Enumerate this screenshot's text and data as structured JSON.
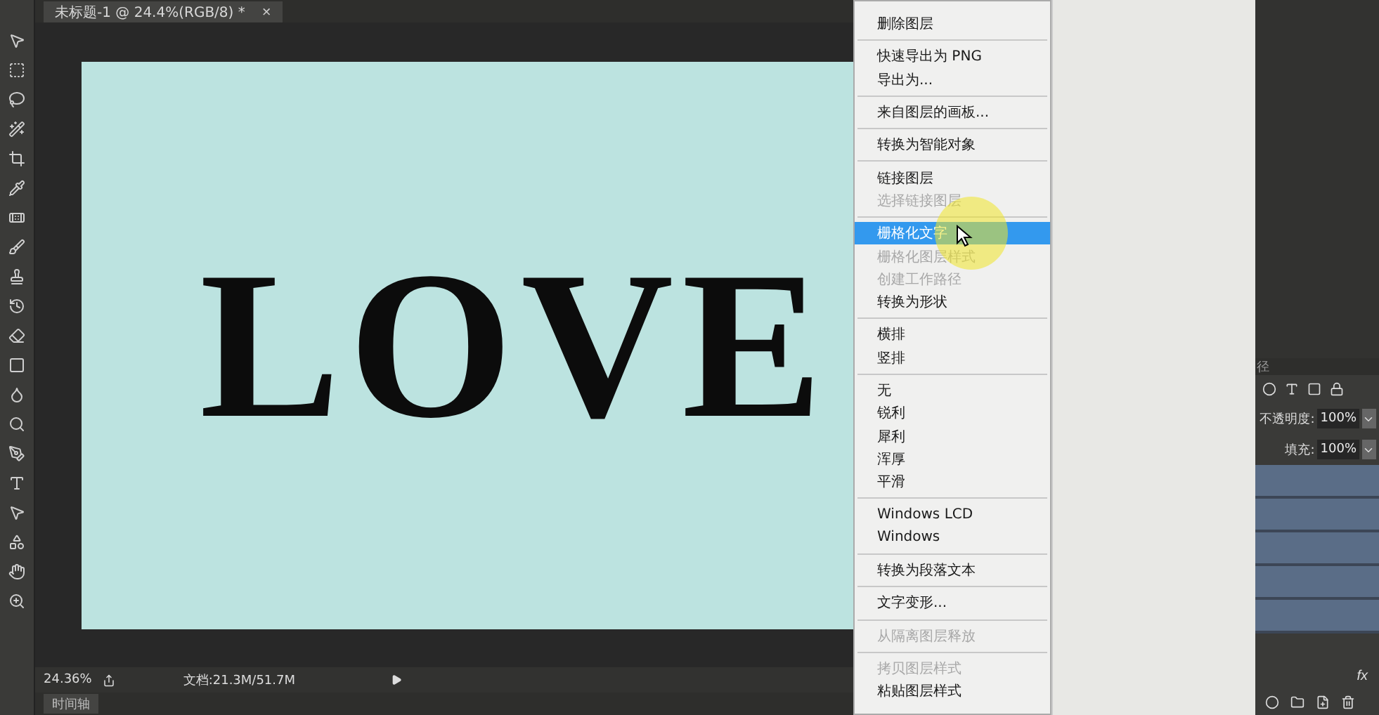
{
  "document_tab": {
    "title": "未标题-1 @ 24.4%(RGB/8) *",
    "close": "×"
  },
  "canvas": {
    "text": "LOVE"
  },
  "context_menu": {
    "items": [
      {
        "kind": "item",
        "label": "删除图层",
        "disabled": false,
        "selected": false
      },
      {
        "kind": "separator"
      },
      {
        "kind": "item",
        "label": "快速导出为 PNG",
        "disabled": false,
        "selected": false
      },
      {
        "kind": "item",
        "label": "导出为...",
        "disabled": false,
        "selected": false
      },
      {
        "kind": "separator"
      },
      {
        "kind": "item",
        "label": "来自图层的画板...",
        "disabled": false,
        "selected": false
      },
      {
        "kind": "separator"
      },
      {
        "kind": "item",
        "label": "转换为智能对象",
        "disabled": false,
        "selected": false
      },
      {
        "kind": "separator"
      },
      {
        "kind": "item",
        "label": "链接图层",
        "disabled": false,
        "selected": false
      },
      {
        "kind": "item",
        "label": "选择链接图层",
        "disabled": true,
        "selected": false
      },
      {
        "kind": "separator"
      },
      {
        "kind": "item",
        "label": "栅格化文字",
        "disabled": false,
        "selected": true
      },
      {
        "kind": "item",
        "label": "栅格化图层样式",
        "disabled": true,
        "selected": false
      },
      {
        "kind": "item",
        "label": "创建工作路径",
        "disabled": true,
        "selected": false
      },
      {
        "kind": "item",
        "label": "转换为形状",
        "disabled": false,
        "selected": false
      },
      {
        "kind": "separator"
      },
      {
        "kind": "item",
        "label": "横排",
        "disabled": false,
        "selected": false
      },
      {
        "kind": "item",
        "label": "竖排",
        "disabled": false,
        "selected": false
      },
      {
        "kind": "separator"
      },
      {
        "kind": "item",
        "label": "无",
        "disabled": false,
        "selected": false
      },
      {
        "kind": "item",
        "label": "锐利",
        "disabled": false,
        "selected": false
      },
      {
        "kind": "item",
        "label": "犀利",
        "disabled": false,
        "selected": false
      },
      {
        "kind": "item",
        "label": "浑厚",
        "disabled": false,
        "selected": false
      },
      {
        "kind": "item",
        "label": "平滑",
        "disabled": false,
        "selected": false
      },
      {
        "kind": "separator"
      },
      {
        "kind": "item",
        "label": "Windows LCD",
        "disabled": false,
        "selected": false
      },
      {
        "kind": "item",
        "label": "Windows",
        "disabled": false,
        "selected": false
      },
      {
        "kind": "separator"
      },
      {
        "kind": "item",
        "label": "转换为段落文本",
        "disabled": false,
        "selected": false
      },
      {
        "kind": "separator"
      },
      {
        "kind": "item",
        "label": "文字变形...",
        "disabled": false,
        "selected": false
      },
      {
        "kind": "separator"
      },
      {
        "kind": "item",
        "label": "从隔离图层释放",
        "disabled": true,
        "selected": false
      },
      {
        "kind": "separator"
      },
      {
        "kind": "item",
        "label": "拷贝图层样式",
        "disabled": true,
        "selected": false
      },
      {
        "kind": "item",
        "label": "粘贴图层样式",
        "disabled": false,
        "selected": false
      }
    ]
  },
  "layers_panel": {
    "tab": "径",
    "opacity_label": "不透明度:",
    "opacity": "100%",
    "fill_label": "填充:",
    "fill": "100%",
    "fx": "fx"
  },
  "status_bar": {
    "zoom": "24.36%",
    "doc_info": "文档:21.3M/51.7M",
    "timeline_tab": "时间轴"
  }
}
